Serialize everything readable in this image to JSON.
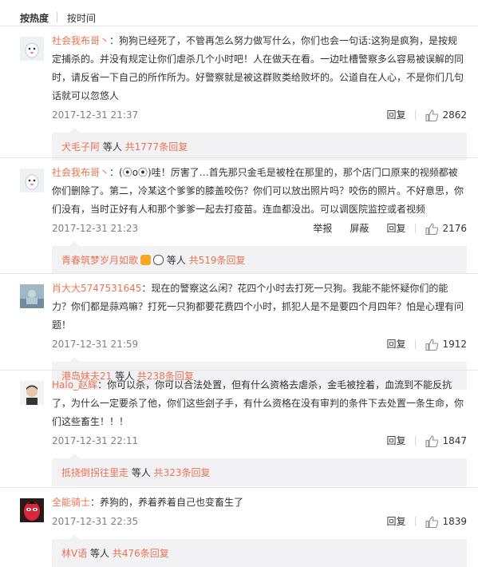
{
  "sort": {
    "hot": "按热度",
    "time": "按时间"
  },
  "comments": [
    {
      "user": "社会我布哥丶",
      "text": "：狗狗已经死了，不管再怎么努力做写什么，你们也会一句话:这狗是疯狗，是按规定捕杀的。并没有规定让你们虐杀几个小时吧！人在做天在看。一边吐槽警察多么容易被误解的同时，请反省一下自己的所作所为。好警察就是被这群败类给败坏的。公道自在人心，不是你们几句话就可以忽悠人",
      "time": "2017-12-31 21:37",
      "actions": [
        "回复"
      ],
      "likes": "2862",
      "reply_user": "犬毛子阿",
      "reply_etc": " 等人 ",
      "reply_count": "共1777条回复"
    },
    {
      "user": "社会我布哥丶",
      "text": "：(⦿o⦿)哇！厉害了…首先那只金毛是被栓在那里的，那个店门口原来的视频都被你们删除了。第二，冷某这个爹爹的膝盖咬伤？你们可以放出照片吗？咬伤的照片。不好意思，你们没有，当时正好有人和那个爹爹一起去打疫苗。连血都没出。可以调医院监控或者视频",
      "time": "2017-12-31 21:23",
      "actions": [
        "举报",
        "屏蔽",
        "回复"
      ],
      "likes": "2176",
      "reply_user": "青春筑梦岁月如歌",
      "reply_etc": " 等人 ",
      "reply_count": "共519条回复"
    },
    {
      "user": "肖大大5747531645",
      "text": "：现在的警察这么闲？花四个小时去打死一只狗。我能不能怀疑你们的能力？你们都是蒜鸡嘛？打死一只狗都要花费四个小时，抓犯人是不是要四个月四年？怕是心理有问题！",
      "time": "2017-12-31 21:59",
      "actions": [
        "回复"
      ],
      "likes": "1912",
      "reply_user": "港岛妹夫21",
      "reply_etc": " 等人 ",
      "reply_count": "共238条回复"
    },
    {
      "user": "Halo_赵辉",
      "text": "：你可以杀，你可以合法处置，但有什么资格去虐杀，金毛被拴着，血流到不能反抗了，为什么一定要杀了他，你们这些刽子手，有什么资格在没有审判的条件下去处置一条生命，你们这些畜生！！！",
      "time": "2017-12-31 22:11",
      "actions": [
        "回复"
      ],
      "likes": "1847",
      "reply_user": "抵挠倒拐往里走",
      "reply_etc": " 等人 ",
      "reply_count": "共323条回复"
    },
    {
      "user": "全能骑士",
      "text": "：养狗的，养着养着自己也变畜生了",
      "time": "2017-12-31 22:35",
      "actions": [
        "回复"
      ],
      "likes": "1839",
      "reply_user": "林V语",
      "reply_etc": " 等人 ",
      "reply_count": "共476条回复"
    }
  ]
}
